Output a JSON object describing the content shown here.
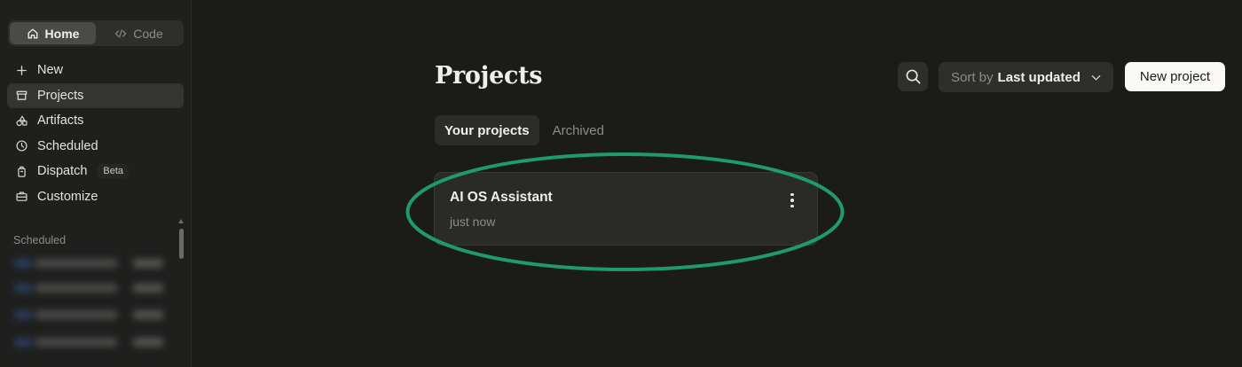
{
  "mode_switch": {
    "home_label": "Home",
    "code_label": "Code"
  },
  "nav": {
    "items": [
      {
        "label": "New",
        "icon": "plus-icon"
      },
      {
        "label": "Projects",
        "icon": "folder-icon"
      },
      {
        "label": "Artifacts",
        "icon": "artifacts-icon"
      },
      {
        "label": "Scheduled",
        "icon": "clock-icon"
      },
      {
        "label": "Dispatch",
        "icon": "dispatch-icon",
        "badge": "Beta"
      },
      {
        "label": "Customize",
        "icon": "briefcase-icon"
      }
    ]
  },
  "sidebar_section": {
    "scheduled_label": "Scheduled"
  },
  "header": {
    "title": "Projects",
    "sort_prefix": "Sort by",
    "sort_value": "Last updated",
    "new_project_label": "New project"
  },
  "tabs": [
    {
      "label": "Your projects"
    },
    {
      "label": "Archived"
    }
  ],
  "projects": [
    {
      "name": "AI OS Assistant",
      "updated": "just now"
    }
  ],
  "colors": {
    "annotation": "#1f9a6a",
    "background": "#1b1b1a",
    "card": "#2a2a28",
    "primary_button": "#faf9f6"
  }
}
